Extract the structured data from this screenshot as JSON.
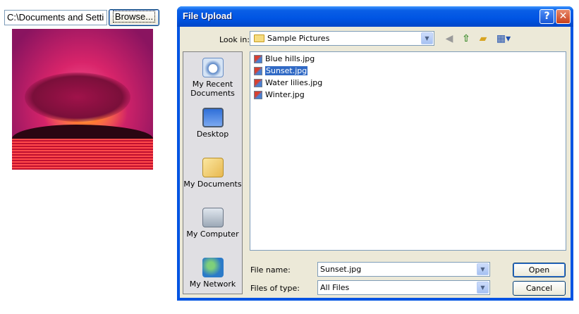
{
  "page": {
    "path_value": "C:\\Documents and Setti",
    "browse_label": "Browse..."
  },
  "dialog": {
    "title": "File Upload",
    "help_glyph": "?",
    "close_glyph": "✕",
    "look_in_label": "Look in:",
    "look_in_value": "Sample Pictures",
    "places": [
      {
        "label": "My Recent Documents",
        "icon": "recent-documents-icon"
      },
      {
        "label": "Desktop",
        "icon": "desktop-icon"
      },
      {
        "label": "My Documents",
        "icon": "my-documents-icon"
      },
      {
        "label": "My Computer",
        "icon": "my-computer-icon"
      },
      {
        "label": "My Network",
        "icon": "my-network-icon"
      }
    ],
    "files": [
      {
        "name": "Blue hills.jpg"
      },
      {
        "name": "Sunset.jpg",
        "selected": true
      },
      {
        "name": "Water lilies.jpg"
      },
      {
        "name": "Winter.jpg"
      }
    ],
    "file_name_label": "File name:",
    "file_name_value": "Sunset.jpg",
    "file_type_label": "Files of type:",
    "file_type_value": "All Files",
    "open_label": "Open",
    "cancel_label": "Cancel"
  },
  "colors": {
    "titlebar": "#0054e3",
    "selection": "#316ac5",
    "dialog_face": "#ece9d8"
  }
}
